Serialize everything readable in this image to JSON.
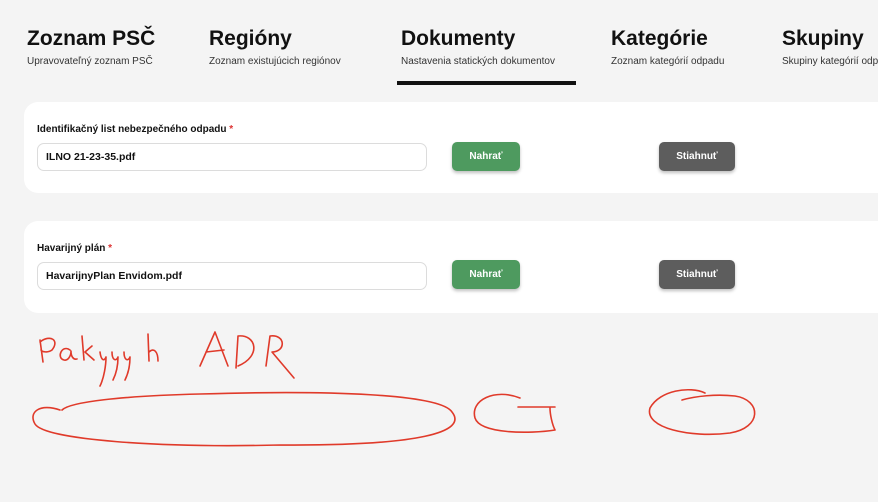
{
  "tabs": [
    {
      "title": "Zoznam PSČ",
      "subtitle": "Upravovateľný zoznam PSČ"
    },
    {
      "title": "Regióny",
      "subtitle": "Zoznam existujúcich regiónov"
    },
    {
      "title": "Dokumenty",
      "subtitle": "Nastavenia statických dokumentov",
      "active": true
    },
    {
      "title": "Kategórie",
      "subtitle": "Zoznam kategórií odpadu"
    },
    {
      "title": "Skupiny",
      "subtitle": "Skupiny kategórií odpadu"
    }
  ],
  "documents": [
    {
      "label": "Identifikačný list nebezpečného odpadu",
      "required_mark": "*",
      "file": "ILNO 21-23-35.pdf",
      "upload_label": "Nahrať",
      "download_label": "Stiahnuť"
    },
    {
      "label": "Havarijný plán",
      "required_mark": "*",
      "file": "HavarijnyPlan Envidom.pdf",
      "upload_label": "Nahrať",
      "download_label": "Stiahnuť"
    }
  ],
  "colors": {
    "upload_button": "#4e9a5f",
    "download_button": "#5d5d5d",
    "required_mark": "#dd3333",
    "scribble": "#e03a2a",
    "active_tab_underline": "#111111"
  }
}
